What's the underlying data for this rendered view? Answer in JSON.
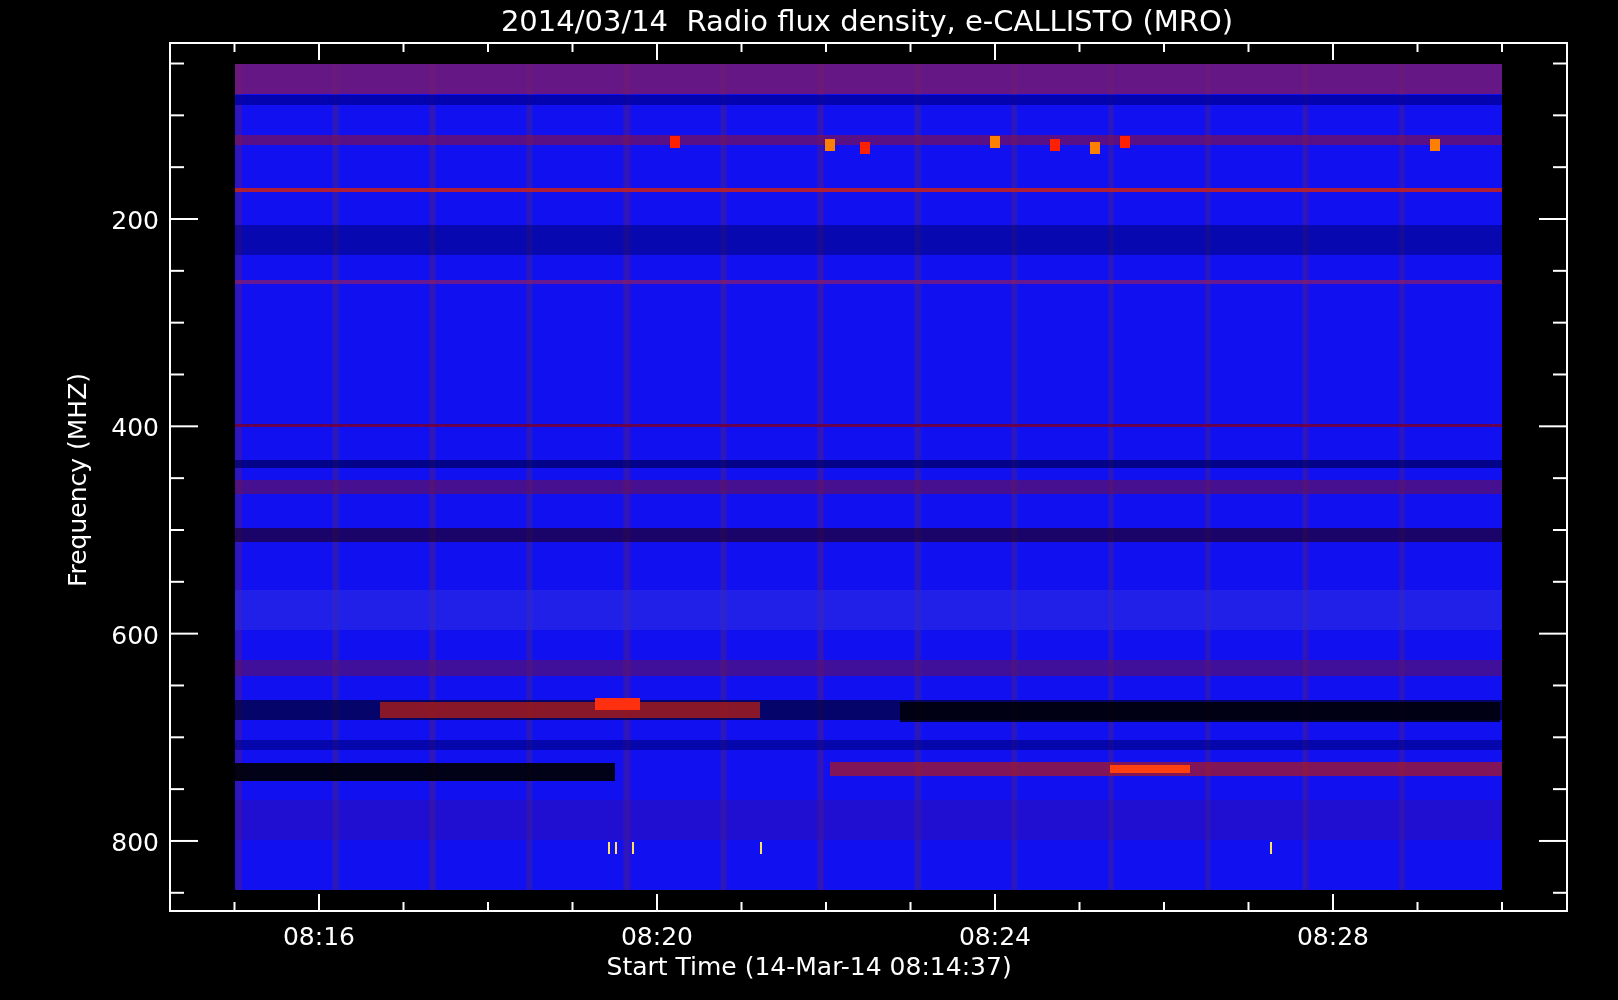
{
  "title": "2014/03/14  Radio flux density, e-CALLISTO (MRO)",
  "y_axis": {
    "label": "Frequency (MHZ)",
    "ticks": [
      "200",
      "400",
      "600",
      "800"
    ]
  },
  "x_axis": {
    "label": "Start Time (14-Mar-14 08:14:37)",
    "ticks": [
      "08:16",
      "08:20",
      "08:24",
      "08:28"
    ]
  }
}
